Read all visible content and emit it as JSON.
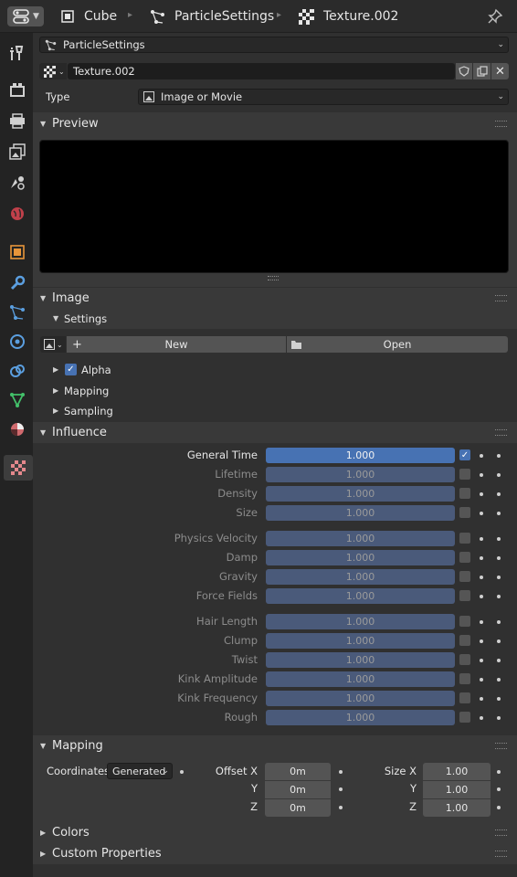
{
  "header": {
    "object_name": "Cube",
    "particle_settings": "ParticleSettings",
    "texture_name": "Texture.002"
  },
  "context": {
    "particle_settings": "ParticleSettings",
    "texture_name": "Texture.002"
  },
  "type_row": {
    "label": "Type",
    "value": "Image or Movie"
  },
  "panels": {
    "preview": "Preview",
    "image": "Image",
    "settings": "Settings",
    "influence": "Influence",
    "mapping": "Mapping",
    "colors": "Colors",
    "custom_properties": "Custom Properties"
  },
  "image": {
    "new_label": "New",
    "open_label": "Open",
    "alpha_label": "Alpha",
    "alpha_checked": true,
    "mapping_label": "Mapping",
    "sampling_label": "Sampling"
  },
  "influence": [
    {
      "label": "General Time",
      "value": "1.000",
      "enabled": true
    },
    {
      "label": "Lifetime",
      "value": "1.000",
      "enabled": false
    },
    {
      "label": "Density",
      "value": "1.000",
      "enabled": false
    },
    {
      "label": "Size",
      "value": "1.000",
      "enabled": false
    },
    {
      "label": "Physics Velocity",
      "value": "1.000",
      "enabled": false
    },
    {
      "label": "Damp",
      "value": "1.000",
      "enabled": false
    },
    {
      "label": "Gravity",
      "value": "1.000",
      "enabled": false
    },
    {
      "label": "Force Fields",
      "value": "1.000",
      "enabled": false
    },
    {
      "label": "Hair Length",
      "value": "1.000",
      "enabled": false
    },
    {
      "label": "Clump",
      "value": "1.000",
      "enabled": false
    },
    {
      "label": "Twist",
      "value": "1.000",
      "enabled": false
    },
    {
      "label": "Kink Amplitude",
      "value": "1.000",
      "enabled": false
    },
    {
      "label": "Kink Frequency",
      "value": "1.000",
      "enabled": false
    },
    {
      "label": "Rough",
      "value": "1.000",
      "enabled": false
    }
  ],
  "mapping": {
    "coordinates_label": "Coordinates",
    "coordinates_value": "Generated",
    "offset_x_label": "Offset X",
    "offset_y_label": "Y",
    "offset_z_label": "Z",
    "offset_x": "0m",
    "offset_y": "0m",
    "offset_z": "0m",
    "size_x_label": "Size X",
    "size_y_label": "Y",
    "size_z_label": "Z",
    "size_x": "1.00",
    "size_y": "1.00",
    "size_z": "1.00"
  },
  "sidebar_tabs": [
    "tool-icon",
    "render-icon",
    "output-icon",
    "view-layer-icon",
    "scene-icon",
    "world-icon",
    "object-icon",
    "modifier-icon",
    "particles-icon",
    "physics-icon",
    "constraints-icon",
    "object-data-icon",
    "material-icon",
    "texture-icon"
  ],
  "colors": {
    "accent": "#4772b3",
    "slider_disabled": "#4a5a7a",
    "panel_bg": "#303030",
    "panel_header": "#393939"
  }
}
